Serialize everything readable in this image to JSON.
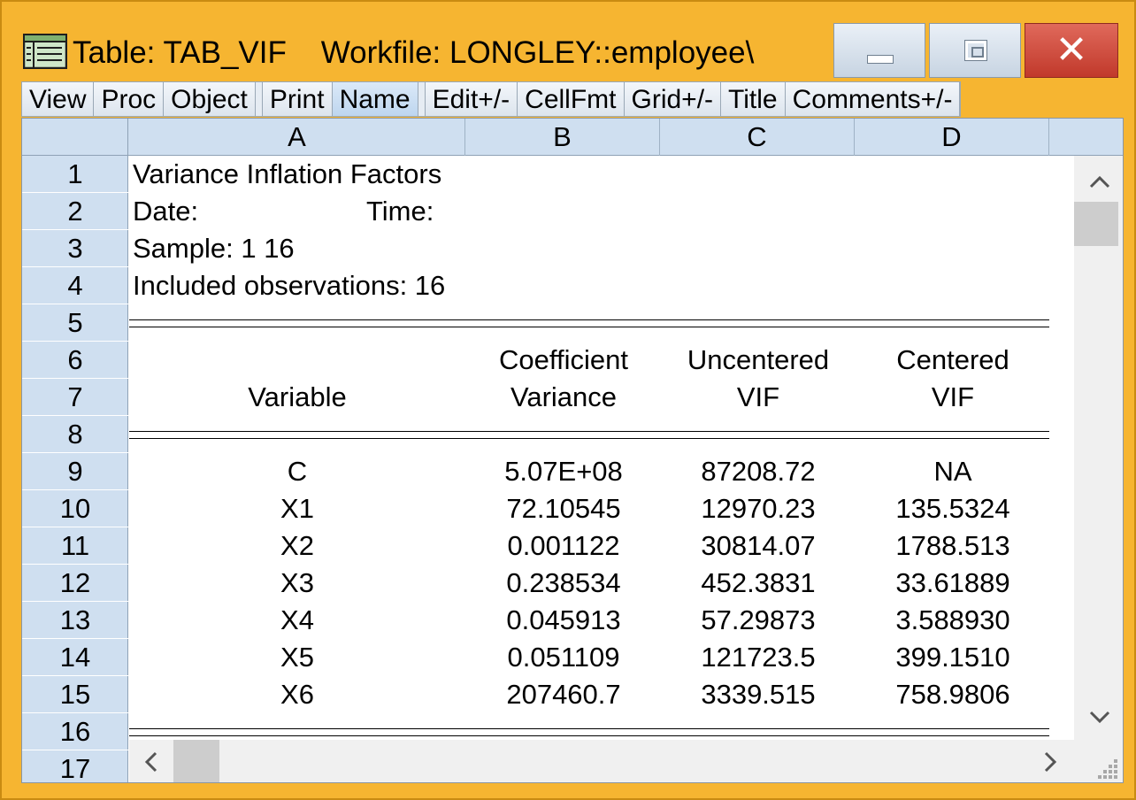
{
  "window": {
    "title": "Table: TAB_VIF    Workfile: LONGLEY::employee\\",
    "colors": {
      "frame": "#f6b531",
      "header": "#cfdff0",
      "close": "#c1392b"
    }
  },
  "icons": {
    "app": "table-icon",
    "minimize": "minimize-icon",
    "maximize": "maximize-icon",
    "close": "close-icon"
  },
  "toolbar": {
    "view": "View",
    "proc": "Proc",
    "object": "Object",
    "print": "Print",
    "name": "Name",
    "edit": "Edit+/-",
    "cellfmt": "CellFmt",
    "grid": "Grid+/-",
    "title": "Title",
    "comments": "Comments+/-"
  },
  "columns": [
    "A",
    "B",
    "C",
    "D"
  ],
  "rows": [
    "1",
    "2",
    "3",
    "4",
    "5",
    "6",
    "7",
    "8",
    "9",
    "10",
    "11",
    "12",
    "13",
    "14",
    "15",
    "16",
    "17"
  ],
  "header": {
    "title": "Variance Inflation Factors",
    "date_label": "Date:",
    "time_label": "Time:",
    "sample": "Sample: 1 16",
    "observations": "Included observations: 16"
  },
  "table": {
    "head_row1": [
      "",
      "Coefficient",
      "Uncentered",
      "Centered"
    ],
    "head_row2": [
      "Variable",
      "Variance",
      "VIF",
      "VIF"
    ],
    "body": [
      [
        "C",
        "5.07E+08",
        "87208.72",
        "NA"
      ],
      [
        "X1",
        "72.10545",
        "12970.23",
        "135.5324"
      ],
      [
        "X2",
        "0.001122",
        "30814.07",
        "1788.513"
      ],
      [
        "X3",
        "0.238534",
        "452.3831",
        "33.61889"
      ],
      [
        "X4",
        "0.045913",
        "57.29873",
        "3.588930"
      ],
      [
        "X5",
        "0.051109",
        "121723.5",
        "399.1510"
      ],
      [
        "X6",
        "207460.7",
        "3339.515",
        "758.9806"
      ]
    ]
  },
  "scroll": {
    "up": "^",
    "down": "v",
    "left": "<",
    "right": ">"
  }
}
